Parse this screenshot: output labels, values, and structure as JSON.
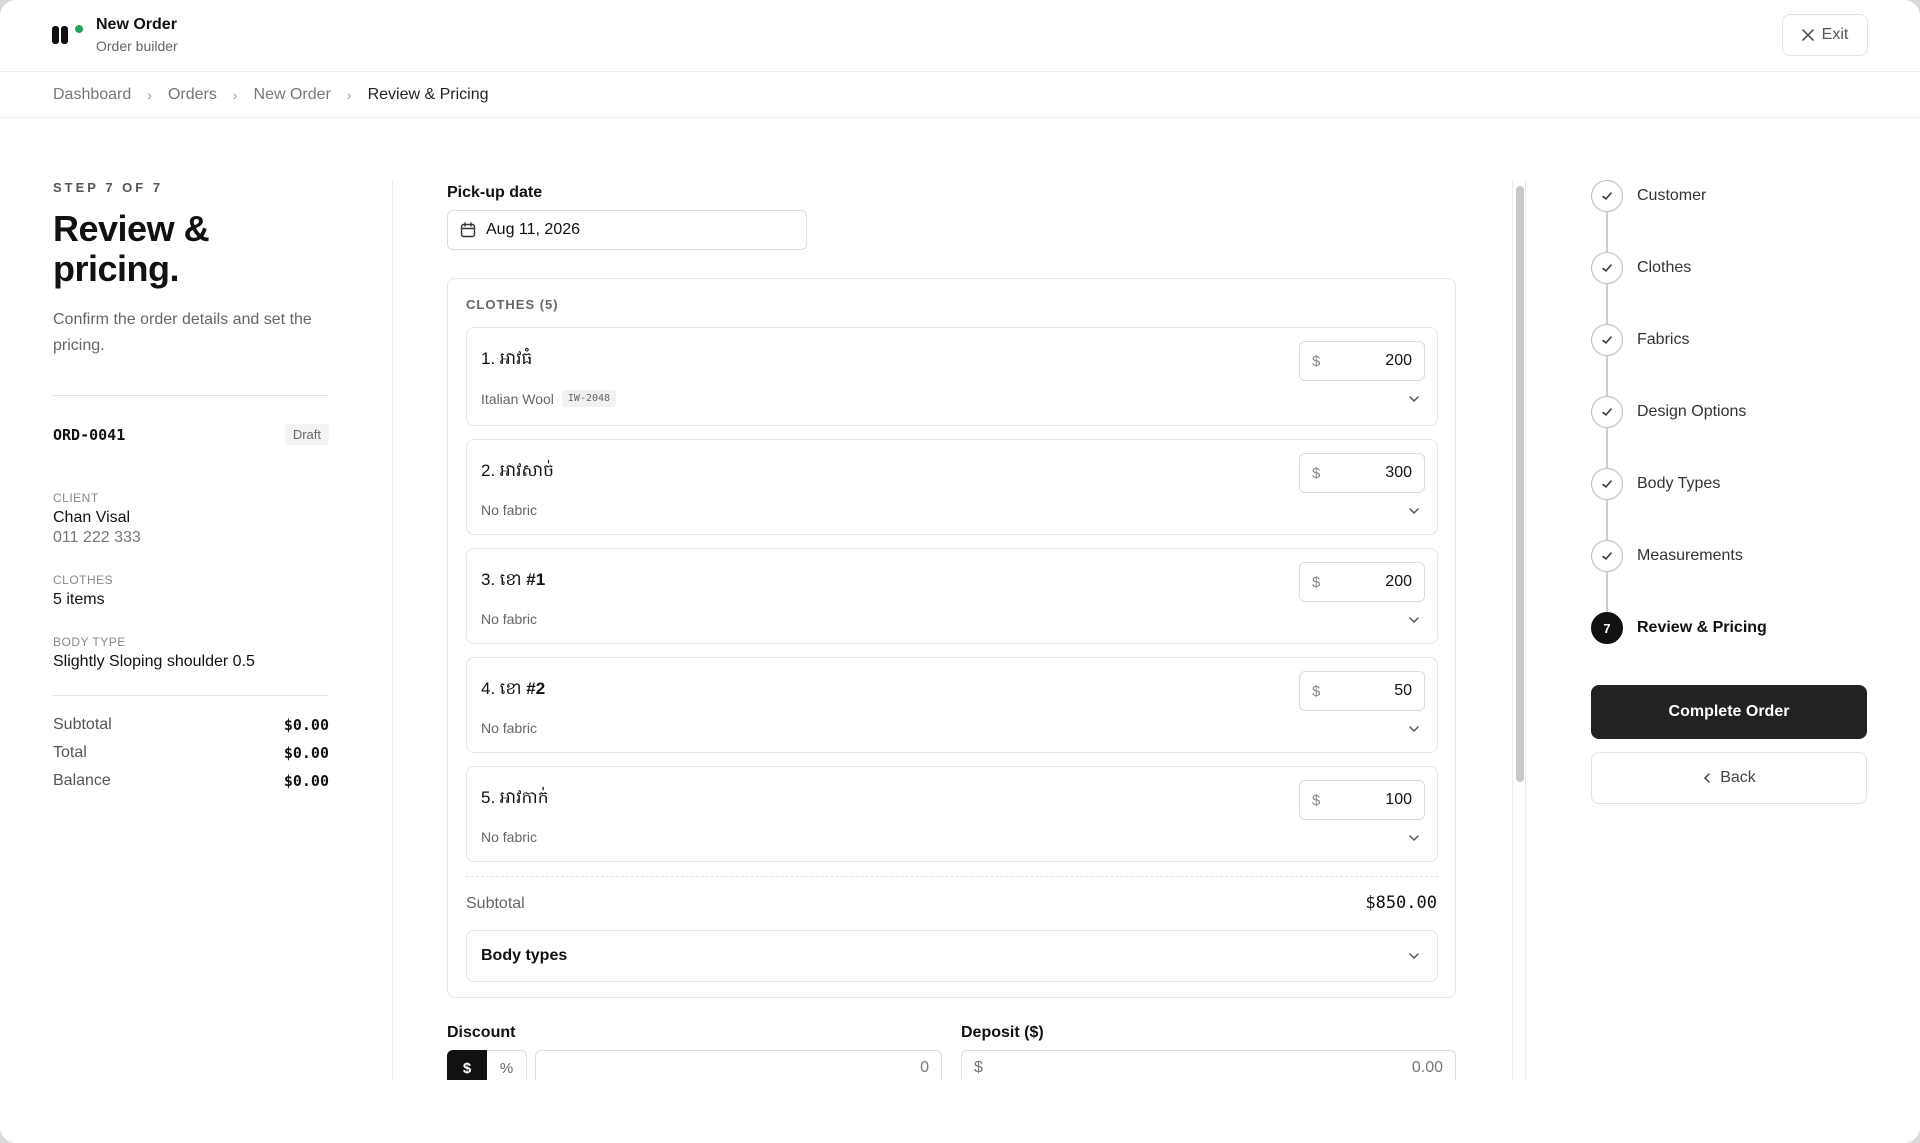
{
  "app": {
    "title": "New Order",
    "subtitle": "Order builder",
    "exit_label": "Exit"
  },
  "breadcrumb": [
    "Dashboard",
    "Orders",
    "New Order",
    "Review & Pricing"
  ],
  "left": {
    "step_label": "STEP 7 OF 7",
    "title": "Review & pricing.",
    "description": "Confirm the order details and set the pricing.",
    "order_id": "ORD-0041",
    "status": "Draft",
    "client_label": "CLIENT",
    "client_name": "Chan Visal",
    "client_phone": "011 222 333",
    "clothes_label": "CLOTHES",
    "clothes_value": "5 items",
    "body_type_label": "BODY TYPE",
    "body_type_value": "Slightly Sloping shoulder 0.5",
    "totals": [
      {
        "label": "Subtotal",
        "value": "$0.00"
      },
      {
        "label": "Total",
        "value": "$0.00"
      },
      {
        "label": "Balance",
        "value": "$0.00"
      }
    ]
  },
  "main": {
    "pickup_label": "Pick-up date",
    "pickup_value": "Aug 11, 2026",
    "clothes_title": "CLOTHES (5)",
    "items": [
      {
        "num": "1.",
        "name": "អាវធំ",
        "suffix": "",
        "fabric": "Italian Wool",
        "code": "IW-2048",
        "currency": "$",
        "price": "200"
      },
      {
        "num": "2.",
        "name": "អាវសាច់",
        "suffix": "",
        "fabric": "No fabric",
        "code": "",
        "currency": "$",
        "price": "300"
      },
      {
        "num": "3.",
        "name": "ខោ",
        "suffix": "#1",
        "fabric": "No fabric",
        "code": "",
        "currency": "$",
        "price": "200"
      },
      {
        "num": "4.",
        "name": "ខោ",
        "suffix": "#2",
        "fabric": "No fabric",
        "code": "",
        "currency": "$",
        "price": "50"
      },
      {
        "num": "5.",
        "name": "អាវកាក់",
        "suffix": "",
        "fabric": "No fabric",
        "code": "",
        "currency": "$",
        "price": "100"
      }
    ],
    "subtotal_label": "Subtotal",
    "subtotal_value": "$850.00",
    "body_types_label": "Body types",
    "discount_label": "Discount",
    "discount_mode_dollar": "$",
    "discount_mode_percent": "%",
    "discount_value": "0",
    "deposit_label": "Deposit ($)",
    "deposit_currency": "$",
    "deposit_value": "0.00"
  },
  "stepper": {
    "steps": [
      {
        "label": "Customer",
        "state": "done"
      },
      {
        "label": "Clothes",
        "state": "done"
      },
      {
        "label": "Fabrics",
        "state": "done"
      },
      {
        "label": "Design Options",
        "state": "done"
      },
      {
        "label": "Body Types",
        "state": "done"
      },
      {
        "label": "Measurements",
        "state": "done"
      },
      {
        "label": "Review & Pricing",
        "state": "active",
        "number": "7"
      }
    ],
    "complete_label": "Complete Order",
    "back_label": "Back"
  },
  "colors": {
    "accent_dot": "#22a35a",
    "primary": "#222222"
  }
}
